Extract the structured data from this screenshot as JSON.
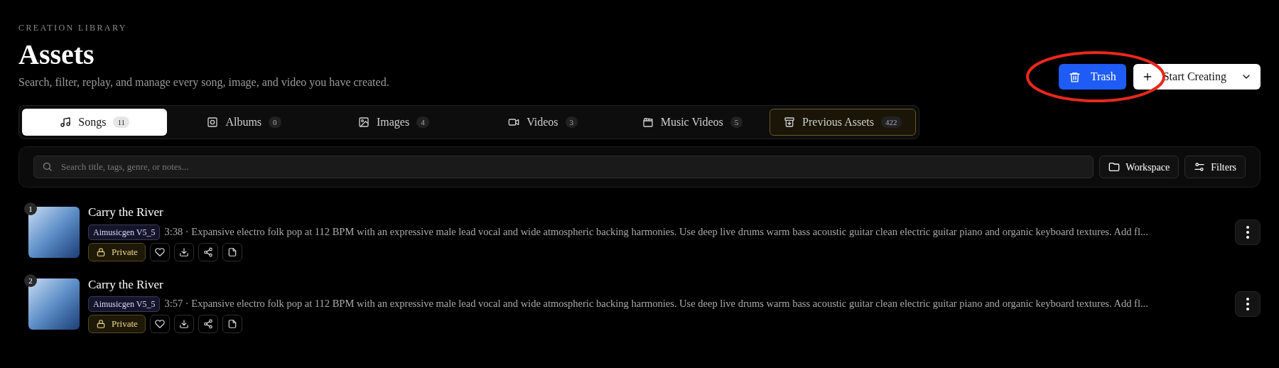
{
  "header": {
    "eyebrow": "CREATION LIBRARY",
    "title": "Assets",
    "subtitle": "Search, filter, replay, and manage every song, image, and video you have created."
  },
  "actions": [
    {
      "kind": "trash",
      "label": "Trash"
    },
    {
      "kind": "create",
      "label": "Start Creating"
    }
  ],
  "annotations": [
    {
      "kind": "ellipse",
      "color": "#e8281c"
    }
  ],
  "tabs": [
    {
      "label": "Songs",
      "count": "11",
      "selected": true,
      "kind": "normal"
    },
    {
      "label": "Albums",
      "count": "0",
      "selected": false,
      "kind": "normal"
    },
    {
      "label": "Images",
      "count": "4",
      "selected": false,
      "kind": "normal"
    },
    {
      "label": "Videos",
      "count": "3",
      "selected": false,
      "kind": "normal"
    },
    {
      "label": "Music Videos",
      "count": "5",
      "selected": false,
      "kind": "normal"
    },
    {
      "label": "Previous Assets",
      "count": "422",
      "selected": false,
      "kind": "highlight"
    }
  ],
  "search": {
    "placeholder": "Search title, tags, genre, or notes..."
  },
  "toolbar": [
    {
      "label": "Workspace"
    },
    {
      "label": "Filters"
    }
  ],
  "songs": [
    {
      "index": "1",
      "title": "Carry the River",
      "model": "Aimusicgen V5_5",
      "description": "3:38 · Expansive electro folk pop at 112 BPM with an expressive male lead vocal and wide atmospheric backing harmonies. Use deep live drums warm bass acoustic guitar clean electric guitar piano and organic keyboard textures. Add fl...",
      "visibility": "Private"
    },
    {
      "index": "2",
      "title": "Carry the River",
      "model": "Aimusicgen V5_5",
      "description": "3:57 · Expansive electro folk pop at 112 BPM with an expressive male lead vocal and wide atmospheric backing harmonies. Use deep live drums warm bass acoustic guitar clean electric guitar piano and organic keyboard textures. Add fl...",
      "visibility": "Private"
    }
  ]
}
